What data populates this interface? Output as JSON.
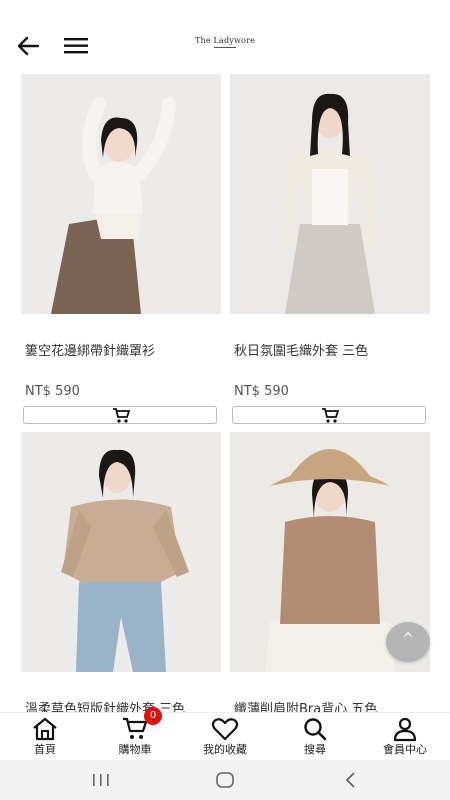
{
  "header": {
    "brand": "The Ladywore",
    "back_icon": "arrow-left-icon",
    "menu_icon": "hamburger-menu-icon"
  },
  "products": [
    {
      "name": "簍空花邊綁帶針織罩衫",
      "price": "NT$ 590"
    },
    {
      "name": "秋日氛圍毛織外套 三色",
      "price": "NT$ 590"
    },
    {
      "name": "溫柔草色短版針織外套 三色",
      "price": ""
    },
    {
      "name": "纖薄削肩附Bra背心 五色",
      "price": ""
    }
  ],
  "scroll_top": {
    "label": "^"
  },
  "tabbar": {
    "items": [
      {
        "label": "首頁",
        "icon": "home-icon"
      },
      {
        "label": "購物車",
        "icon": "cart-icon",
        "badge": "0"
      },
      {
        "label": "我的收藏",
        "icon": "heart-icon"
      },
      {
        "label": "搜尋",
        "icon": "search-icon"
      },
      {
        "label": "會員中心",
        "icon": "user-icon"
      }
    ]
  },
  "colors": {
    "badge": "#e01010",
    "photo_bg": "#eeeceb"
  }
}
